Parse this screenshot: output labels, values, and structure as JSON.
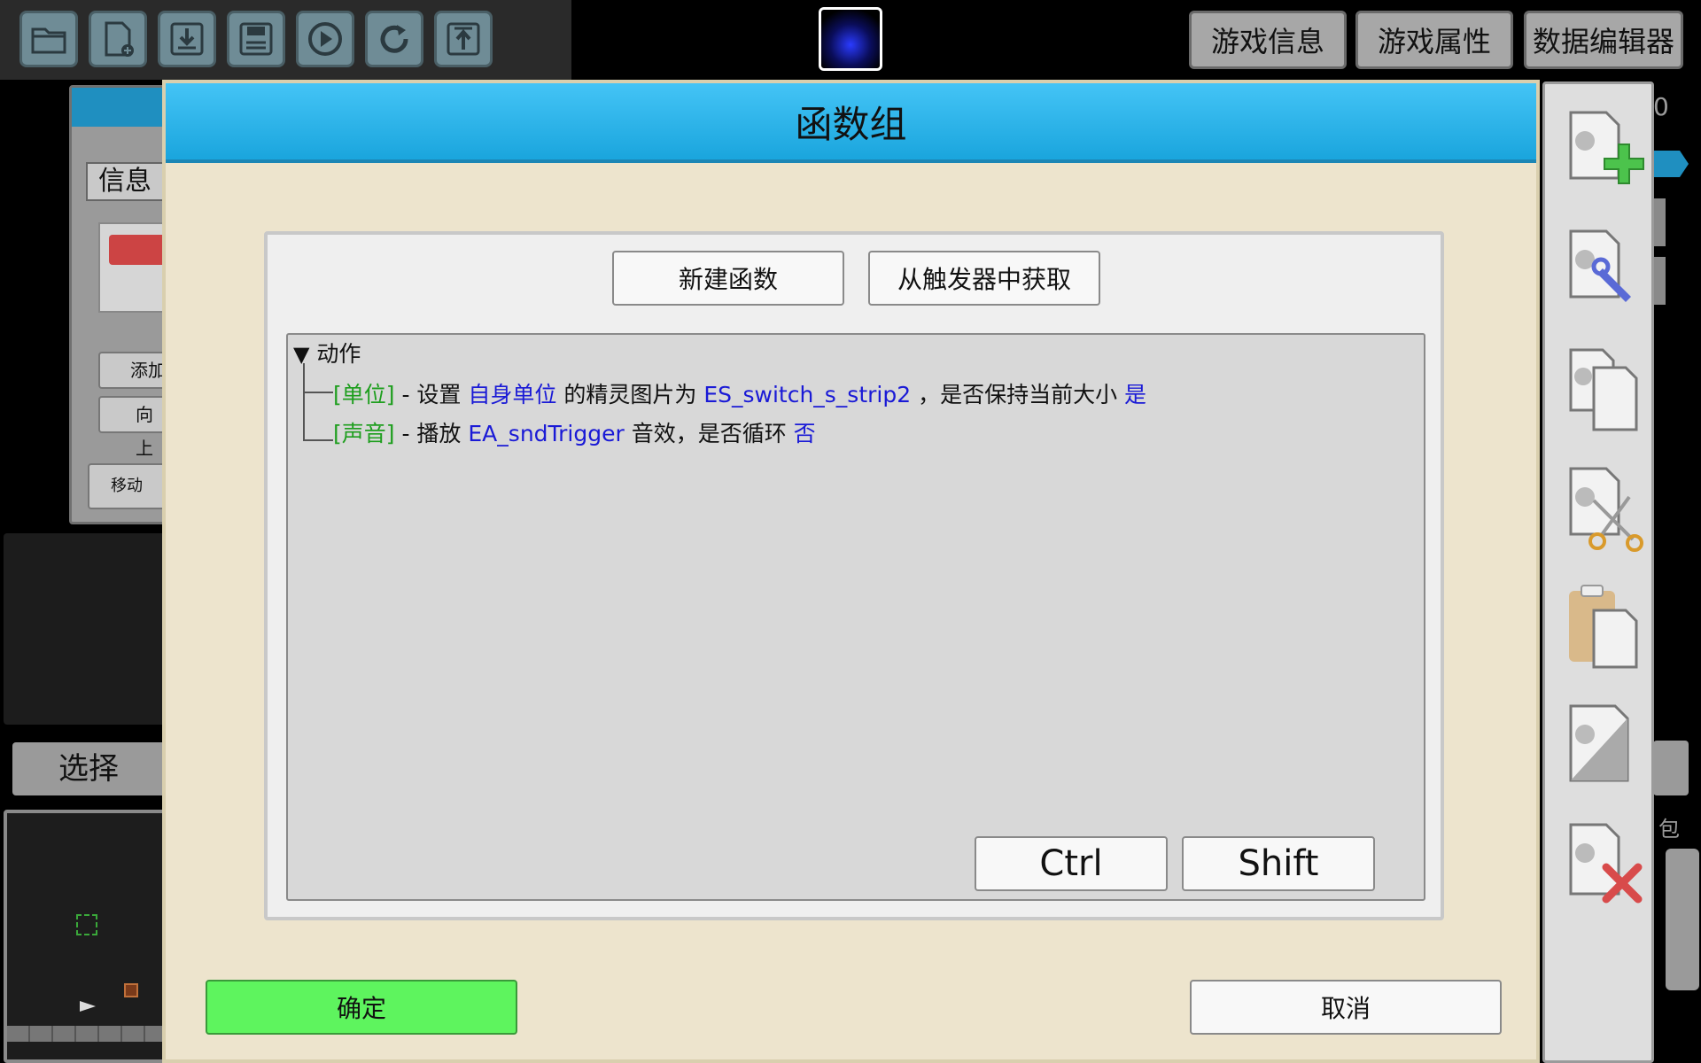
{
  "toolbar": {
    "icons": [
      "open-folder-icon",
      "new-file-icon",
      "download-icon",
      "save-icon",
      "play-icon",
      "refresh-icon",
      "upload-icon"
    ],
    "right_buttons": [
      "游戏信息",
      "游戏属性",
      "数据编辑器"
    ]
  },
  "background": {
    "info_tab": "信息",
    "add_label": "添加",
    "direction_label": "向上",
    "move_label": "移动",
    "select_label": "选择",
    "right_number": "0",
    "right_pack_label": "包"
  },
  "dialog": {
    "title": "函数组",
    "new_function": "新建函数",
    "get_from_trigger": "从触发器中获取",
    "tree": {
      "root": "动作",
      "rows": [
        {
          "category": "[单位]",
          "sep": " - 设置 ",
          "p1": "自身单位",
          "t2": " 的精灵图片为 ",
          "p2": "ES_switch_s_strip2",
          "t3": " ，是否保持当前大小 ",
          "p3": "是"
        },
        {
          "category": "[声音]",
          "sep": " - 播放 ",
          "p1": "EA_sndTrigger",
          "t2": " 音效，是否循环 ",
          "p2": "否"
        }
      ]
    },
    "ctrl": "Ctrl",
    "shift": "Shift",
    "ok": "确定",
    "cancel": "取消"
  },
  "side_tools": [
    "add-page-icon",
    "edit-page-icon",
    "copy-page-icon",
    "cut-page-icon",
    "paste-page-icon",
    "blank-page-icon",
    "delete-page-icon"
  ],
  "colors": {
    "title_bar": "#2bb4ec",
    "dialog_bg": "#ede4cd",
    "ok_button": "#5ef45e",
    "category_green": "#1e9e1e",
    "param_blue": "#1a1ad6"
  }
}
